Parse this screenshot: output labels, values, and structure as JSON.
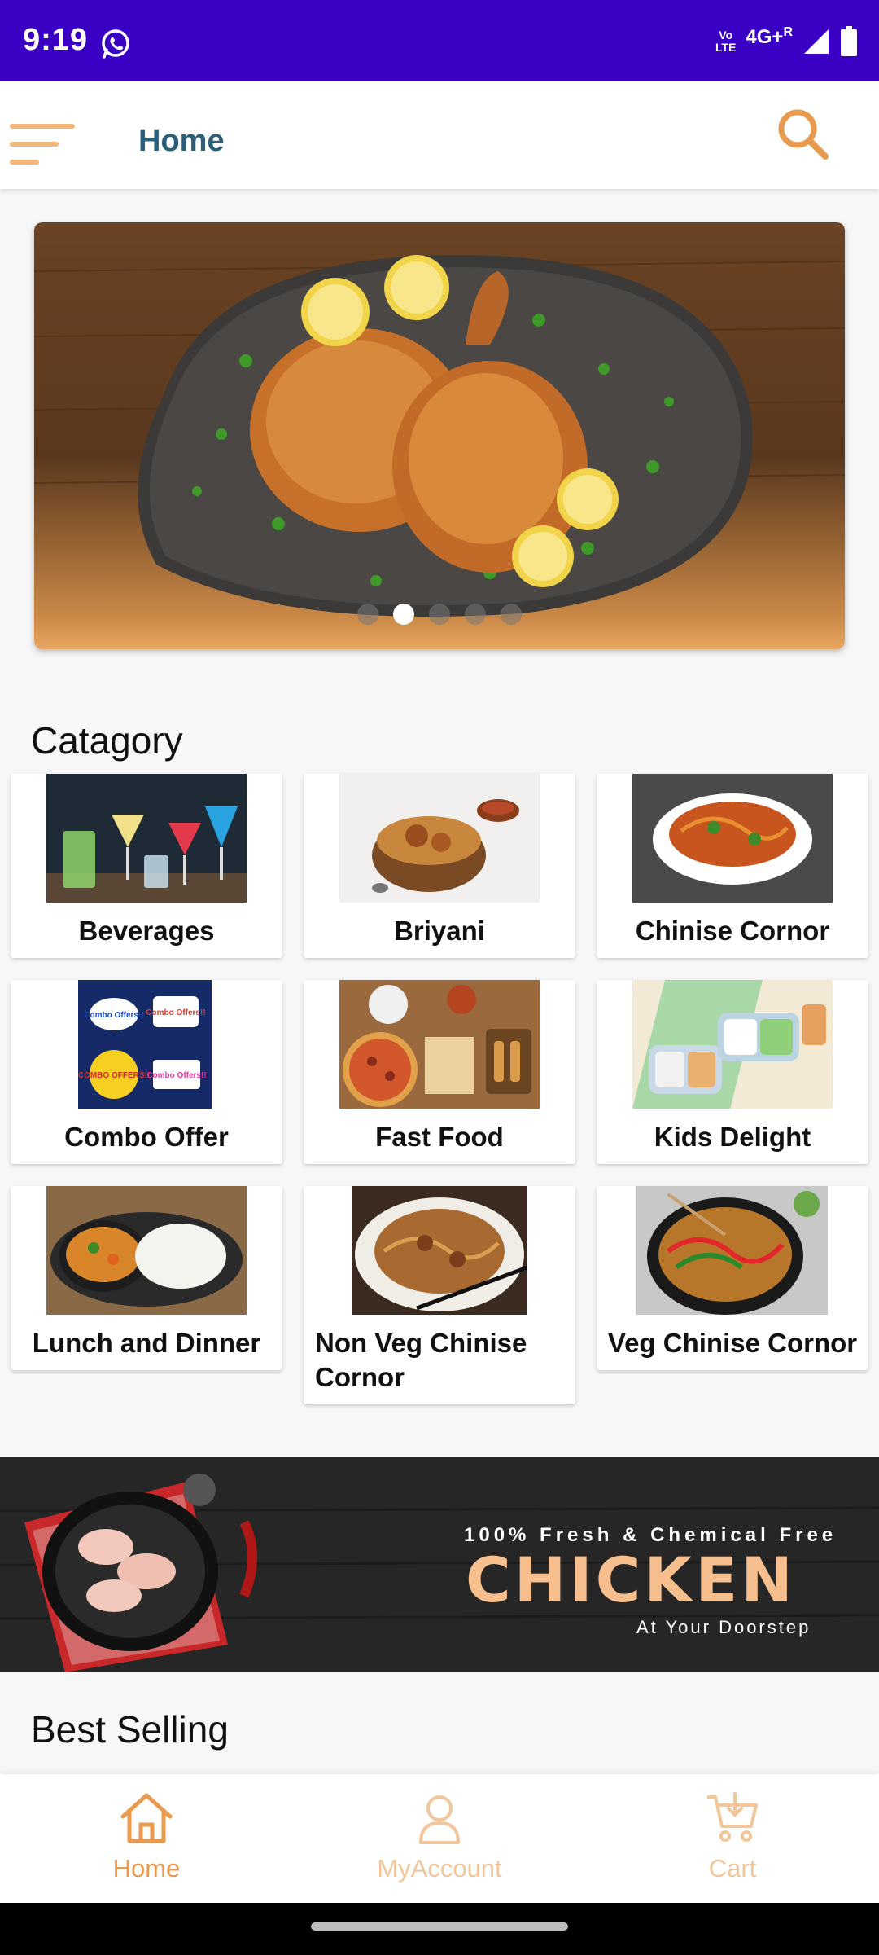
{
  "status_bar": {
    "time": "9:19",
    "volte_line1": "Vo",
    "volte_line2": "LTE",
    "network": "4G+",
    "roaming": "R"
  },
  "app_bar": {
    "title": "Home"
  },
  "category": {
    "title": "Catagory",
    "items": [
      {
        "label": "Beverages"
      },
      {
        "label": "Briyani"
      },
      {
        "label": "Chinise Cornor"
      },
      {
        "label": "Combo Offer",
        "img_text": [
          "Combo Offers!!",
          "Combo Offers!!",
          "COMBO OFFERS!!",
          "Combo Offers!!"
        ]
      },
      {
        "label": "Fast Food"
      },
      {
        "label": "Kids Delight"
      },
      {
        "label": "Lunch and Dinner"
      },
      {
        "label": "Non Veg Chinise Cornor"
      },
      {
        "label": "Veg Chinise Cornor"
      }
    ]
  },
  "promo": {
    "subtitle": "100% Fresh & Chemical Free",
    "title": "CHICKEN",
    "tagline": "At Your Doorstep"
  },
  "best_selling": {
    "title": "Best Selling"
  },
  "bottom_nav": {
    "items": [
      {
        "label": "Home",
        "icon": "home-icon",
        "active": true
      },
      {
        "label": "MyAccount",
        "icon": "user-icon",
        "active": false
      },
      {
        "label": "Cart",
        "icon": "cart-icon",
        "active": false
      }
    ]
  },
  "colors": {
    "status_bar": "#3a00c4",
    "title": "#2b5e78",
    "accent": "#e89a4e",
    "accent_muted": "#f2c69b"
  },
  "carousel": {
    "slides": 5,
    "active_index": 1
  }
}
